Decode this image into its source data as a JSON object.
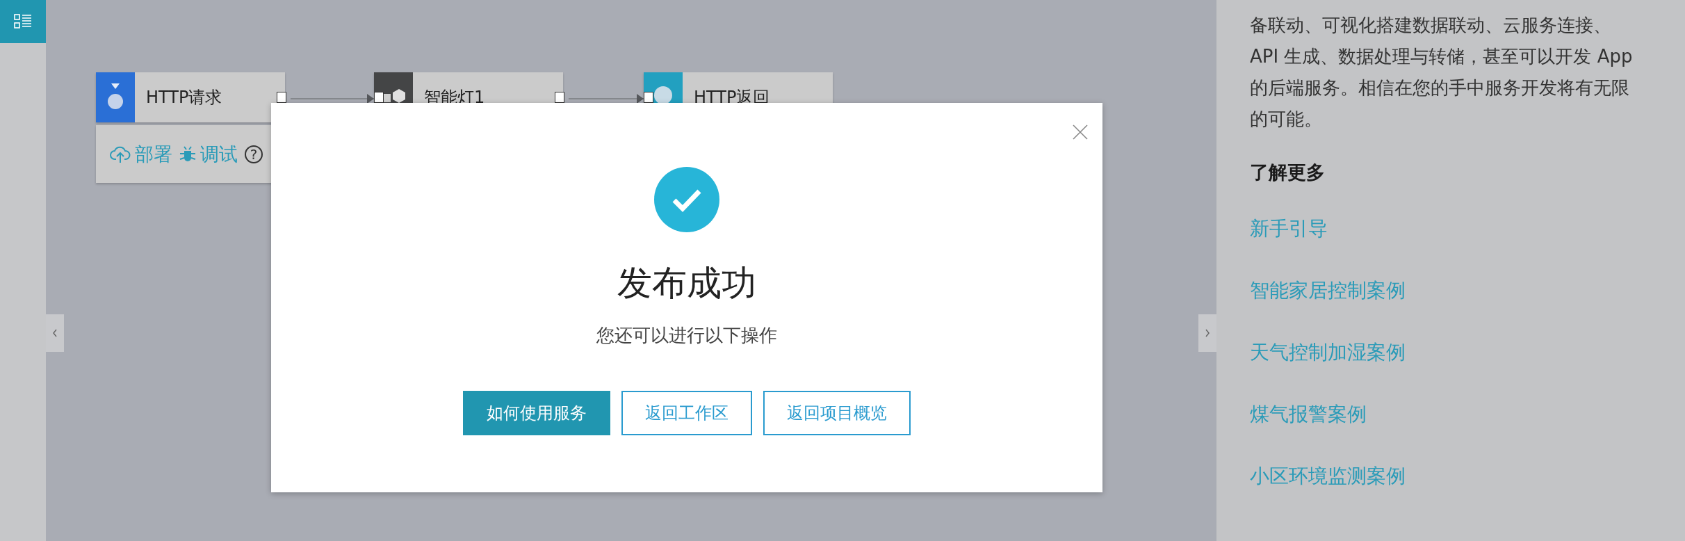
{
  "canvas": {
    "nodes": [
      {
        "label": "HTTP请求",
        "kind": "request"
      },
      {
        "label": "智能灯1",
        "kind": "device"
      },
      {
        "label": "HTTP返回",
        "kind": "response"
      }
    ],
    "node_toolbar": {
      "actions": [
        {
          "label": "部署",
          "kind": "deploy"
        },
        {
          "label": "调试",
          "kind": "debug"
        }
      ],
      "help": "?"
    }
  },
  "modal": {
    "title": "发布成功",
    "message": "您还可以进行以下操作",
    "buttons": [
      {
        "label": "如何使用服务",
        "kind": "primary"
      },
      {
        "label": "返回工作区",
        "kind": "secondary"
      },
      {
        "label": "返回项目概览",
        "kind": "secondary"
      }
    ]
  },
  "help_panel": {
    "description": "备联动、可视化搭建数据联动、云服务连接、API 生成、数据处理与转储，甚至可以开发 App 的后端服务。相信在您的手中服务开发将有无限的可能。",
    "heading": "了解更多",
    "links": [
      "新手引导",
      "智能家居控制案例",
      "天气控制加湿案例",
      "煤气报警案例",
      "小区环境监测案例"
    ]
  }
}
